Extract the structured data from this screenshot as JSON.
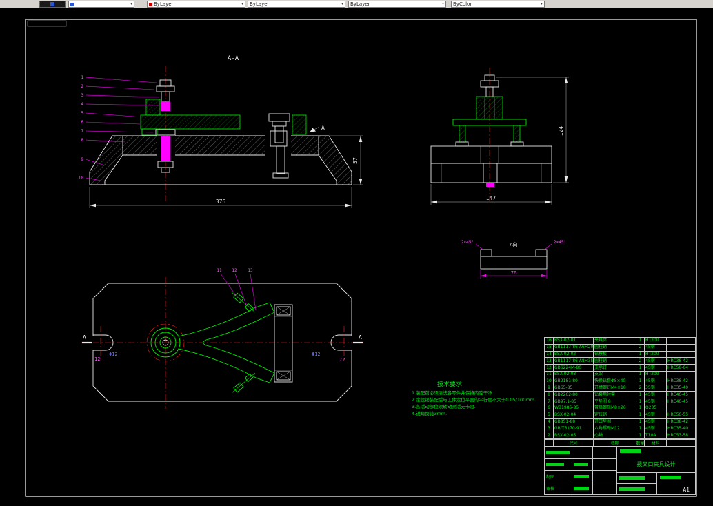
{
  "toolbar": {
    "items": [
      "",
      "ByLayer",
      "ByLayer",
      "ByLayer",
      "ByColor"
    ]
  },
  "drawing": {
    "section_label": "A-A",
    "detail_view_label": "A向",
    "marks": {
      "section_arrow": "A",
      "plan_left": "A",
      "plan_right": "A"
    },
    "dims": {
      "base_length": "376",
      "base_height": "57",
      "side_width": "147",
      "side_height": "124",
      "detail_width": "76",
      "chamfer_left": "2×45°",
      "chamfer_right": "2×45°",
      "notch_width_left": "12",
      "notch_dia_left": "Φ12",
      "notch_dia_right": "Φ12",
      "notch_width_right": "72"
    },
    "section_leaders": [
      "1",
      "2",
      "3",
      "4",
      "5",
      "6",
      "7",
      "8",
      "9",
      "10"
    ],
    "plan_leaders": [
      "11",
      "12",
      "13"
    ]
  },
  "tech_req": {
    "title": "技术要求",
    "items": [
      "1.装配前必须清洗各零件并保持内腔干净.",
      "2.定位销装配后与工件定位平面的平行度不大于0.05/100mm.",
      "3.各活动部位须转动灵活无卡阻.",
      "4.锐角倒钝3mm."
    ]
  },
  "parts_table": {
    "rows": [
      {
        "no": "16",
        "code": "BSX-02-01",
        "name": "夹具体",
        "qty": "1",
        "mat": "HT200",
        "note": ""
      },
      {
        "no": "15",
        "code": "GB1117-86 A6×20",
        "name": "圆柱销",
        "qty": "2",
        "mat": "45钢",
        "note": ""
      },
      {
        "no": "14",
        "code": "BSX-02-02",
        "name": "钻模板",
        "qty": "1",
        "mat": "HT200",
        "note": ""
      },
      {
        "no": "13",
        "code": "GB1117-86 A8×35",
        "name": "圆柱销",
        "qty": "2",
        "mat": "45钢",
        "note": "HRC38-42"
      },
      {
        "no": "12",
        "code": "GB6224M-80",
        "name": "支承钉",
        "qty": "1",
        "mat": "45钢",
        "note": "HRC58-64"
      },
      {
        "no": "11",
        "code": "BSX-02-03",
        "name": "支架",
        "qty": "1",
        "mat": "HT200",
        "note": ""
      },
      {
        "no": "10",
        "code": "GB2181-80",
        "name": "快换钻套Φ8×40",
        "qty": "1",
        "mat": "45钢",
        "note": "HRC38-42"
      },
      {
        "no": "9",
        "code": "GB65-85",
        "name": "开槽螺钉M4×18",
        "qty": "2",
        "mat": "35钢",
        "note": "HRC35-40"
      },
      {
        "no": "8",
        "code": "GB2262-80",
        "name": "钻套用衬套",
        "qty": "1",
        "mat": "45钢",
        "note": "HRC40-45"
      },
      {
        "no": "7",
        "code": "GB97.1-85",
        "name": "平垫圈 8",
        "qty": "1",
        "mat": "45钢",
        "note": "HRC40-45"
      },
      {
        "no": "6",
        "code": "WB1985-85",
        "name": "带肩螺母M8×20",
        "qty": "1",
        "mat": "Q235",
        "note": ""
      },
      {
        "no": "5",
        "code": "BSX-02-04",
        "name": "定位销",
        "qty": "1",
        "mat": "45钢",
        "note": "HRC50-55"
      },
      {
        "no": "4",
        "code": "GB851-88",
        "name": "开口垫圈",
        "qty": "1",
        "mat": "45钢",
        "note": "HRC38-42"
      },
      {
        "no": "3",
        "code": "GB/T6170-91",
        "name": "六角螺母M12",
        "qty": "1",
        "mat": "45钢",
        "note": "HRC35-40"
      },
      {
        "no": "2",
        "code": "BSX-02-05",
        "name": "心轴",
        "qty": "1",
        "mat": "T10A",
        "note": "HRC53-58"
      }
    ]
  },
  "title_block": {
    "header": {
      "code": "代号",
      "name": "名称",
      "qty": "数量",
      "mat": "材料"
    },
    "labels": {
      "draw": "制图",
      "check": "审核"
    },
    "title": "拨叉口夹具设计",
    "sheet": "A1"
  }
}
